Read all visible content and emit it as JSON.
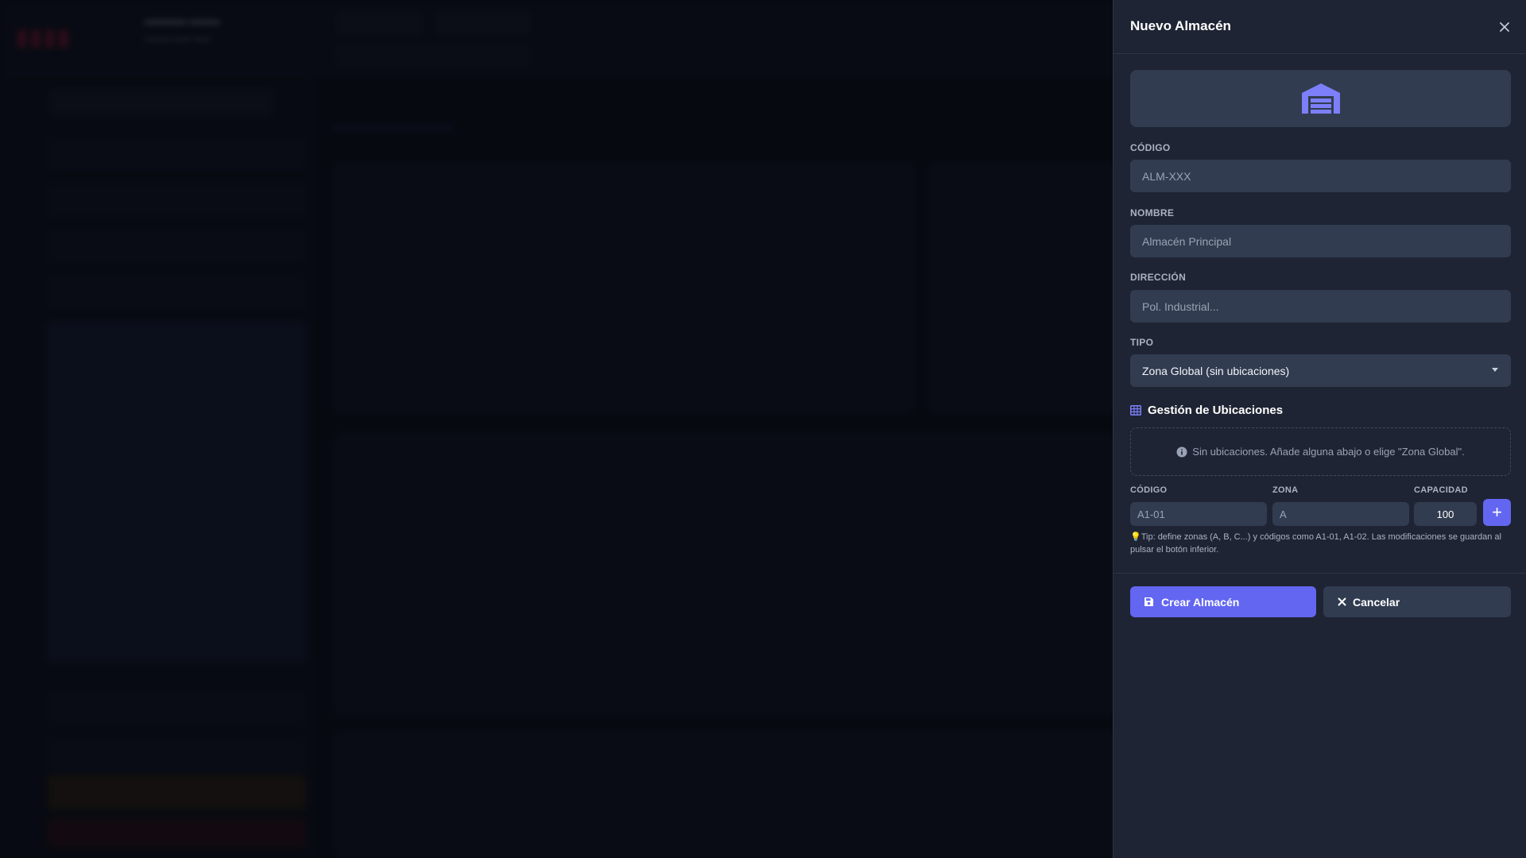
{
  "colors": {
    "accent": "#6366f1",
    "drawer_bg": "#1e2433",
    "input_bg": "#323c50",
    "tip_bulb": "#f5b82e"
  },
  "drawer": {
    "title": "Nuevo Almacén",
    "close_icon": "close-icon",
    "hero_icon": "warehouse-icon",
    "fields": {
      "codigo": {
        "label": "CÓDIGO",
        "placeholder": "ALM-XXX",
        "value": ""
      },
      "nombre": {
        "label": "NOMBRE",
        "placeholder": "Almacén Principal",
        "value": ""
      },
      "direccion": {
        "label": "DIRECCIÓN",
        "placeholder": "Pol. Industrial...",
        "value": ""
      },
      "tipo": {
        "label": "TIPO",
        "selected": "Zona Global (sin ubicaciones)"
      }
    },
    "locations": {
      "section_icon": "grid-icon",
      "title": "Gestión de Ubicaciones",
      "empty_message": "Sin ubicaciones. Añade alguna abajo o elige \"Zona Global\".",
      "new_row": {
        "codigo_label": "CÓDIGO",
        "codigo_placeholder": "A1-01",
        "zona_label": "ZONA",
        "zona_placeholder": "A",
        "capacidad_label": "CAPACIDAD",
        "capacidad_value": "100",
        "add_label": "+"
      },
      "tip": "Tip: define zonas (A, B, C...) y códigos como A1-01, A1-02. Las modificaciones se guardan al pulsar el botón inferior."
    },
    "actions": {
      "create_label": "Crear Almacén",
      "cancel_label": "Cancelar"
    }
  }
}
